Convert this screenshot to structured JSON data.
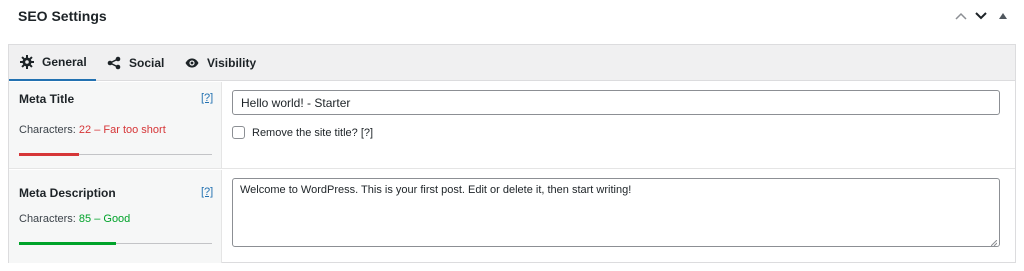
{
  "panel": {
    "title": "SEO Settings",
    "controls": [
      "chevron-up-icon",
      "chevron-down-icon",
      "collapse-triangle-icon"
    ]
  },
  "tabs": [
    {
      "label": "General",
      "icon": "gear-icon",
      "active": true
    },
    {
      "label": "Social",
      "icon": "share-icon",
      "active": false
    },
    {
      "label": "Visibility",
      "icon": "eye-icon",
      "active": false
    }
  ],
  "meta_title": {
    "label": "Meta Title",
    "help": "[?]",
    "characters_label": "Characters:",
    "characters_status": "22 – Far too short",
    "status_color": "#d63638",
    "progress": 0.31,
    "value": "Hello world! - Starter",
    "remove_site_title_label": "Remove the site title? [?]",
    "remove_site_title_checked": false
  },
  "meta_description": {
    "label": "Meta Description",
    "help": "[?]",
    "characters_label": "Characters:",
    "characters_status": "85 – Good",
    "status_color": "#00a32a",
    "progress": 0.5,
    "value": "Welcome to WordPress. This is your first post. Edit or delete it, then start writing!"
  }
}
